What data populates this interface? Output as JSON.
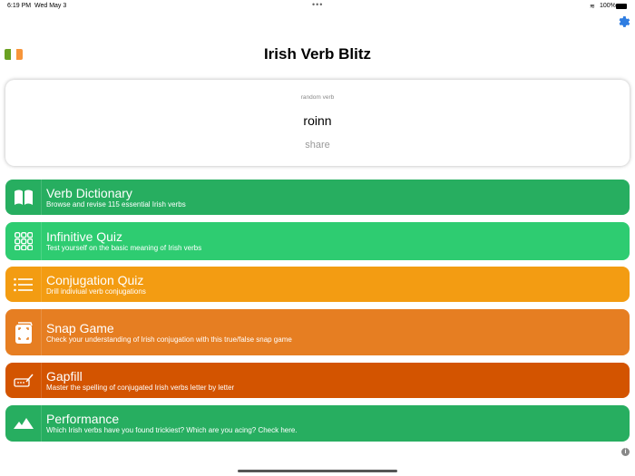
{
  "status": {
    "time": "6:19 PM",
    "date": "Wed May 3",
    "battery": "100%"
  },
  "header": {
    "title": "Irish Verb Blitz",
    "flag_colors": [
      "#6aa121",
      "#ffffff",
      "#f7953a"
    ],
    "settings_icon": "gear-icon"
  },
  "random_verb": {
    "label": "random verb",
    "verb": "roinn",
    "share": "share"
  },
  "menu": [
    {
      "title": "Verb Dictionary",
      "subtitle": "Browse and revise 115 essential Irish verbs",
      "color": "#27ae60",
      "icon": "book-icon"
    },
    {
      "title": "Infinitive Quiz",
      "subtitle": "Test yourself on the basic meaning of Irish verbs",
      "color": "#2ecc71",
      "icon": "grid-icon"
    },
    {
      "title": "Conjugation Quiz",
      "subtitle": "Drill indiviual verb conjugations",
      "color": "#f39c12",
      "icon": "list-icon"
    },
    {
      "title": "Snap Game",
      "subtitle": "Check your understanding of Irish conjugation with this true/false snap game",
      "color": "#e67e22",
      "icon": "cards-icon"
    },
    {
      "title": "Gapfill",
      "subtitle": "Master the spelling of conjugated Irish verbs letter by letter",
      "color": "#d35400",
      "icon": "keyboard-pencil-icon"
    },
    {
      "title": "Performance",
      "subtitle": "Which Irish verbs have you found trickiest? Which are you acing? Check here.",
      "color": "#27ae60",
      "icon": "mountains-icon"
    }
  ],
  "footer": {
    "info": "i"
  }
}
